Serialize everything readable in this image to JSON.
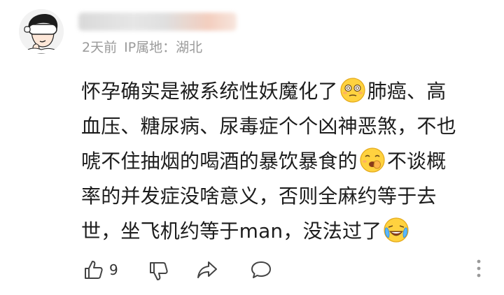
{
  "comment": {
    "meta": {
      "time": "2天前",
      "ip_location": "IP属地：湖北"
    },
    "body_lines": [
      [
        "怀孕确实是被系统性妖魔化了",
        "肺癌、高"
      ],
      [
        "血压、糖尿病、尿毒症个个凶神恶煞，不也"
      ],
      [
        "唬不住抽烟的喝酒的暴饮暴食的",
        "不谈概"
      ],
      [
        "率的并发症没啥意义，否则全麻约等于去"
      ],
      [
        "世，坐飞机约等于man，没法过了"
      ]
    ],
    "emojis": [
      "dizzy-face-emoji",
      "yawning-face-emoji",
      "laughing-crying-emoji"
    ]
  },
  "actions": {
    "like_count": "9",
    "icons": [
      "thumbs-up-icon",
      "thumbs-down-icon",
      "share-icon",
      "comment-icon",
      "more-icon"
    ]
  },
  "colors": {
    "meta_text": "#9a9a9a",
    "body_text": "#1c1c1c",
    "icon": "#444444",
    "emoji_yellow": "#ffd23f"
  }
}
